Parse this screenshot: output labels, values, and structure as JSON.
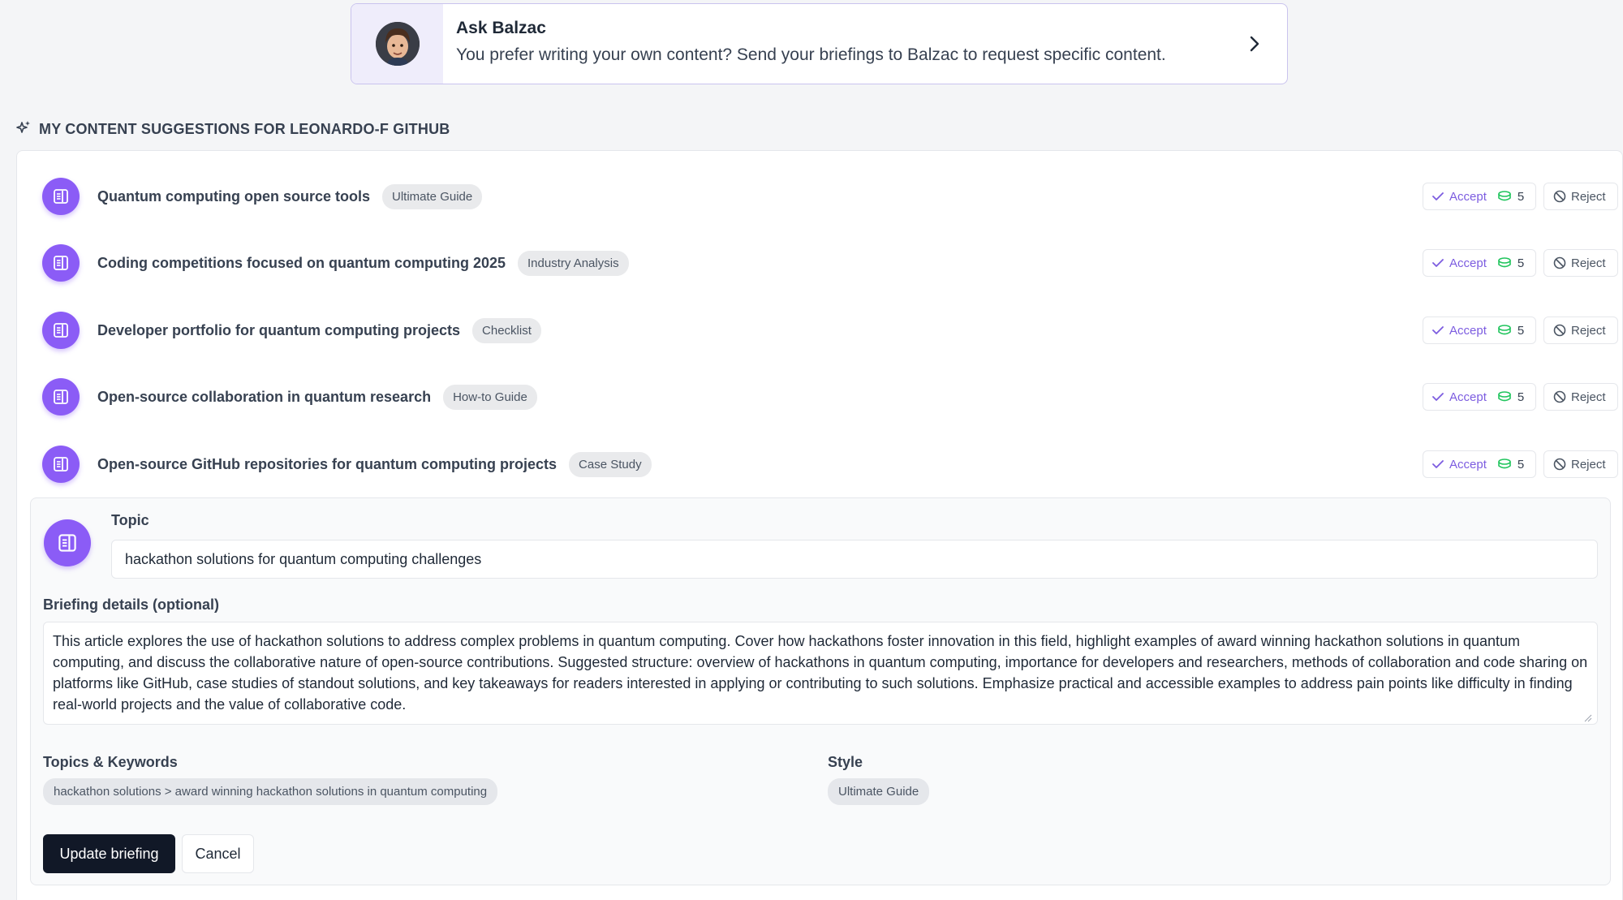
{
  "ask_banner": {
    "title": "Ask Balzac",
    "description": "You prefer writing your own content? Send your briefings to Balzac to request specific content."
  },
  "section": {
    "heading": "MY CONTENT SUGGESTIONS FOR LEONARDO-F GITHUB"
  },
  "suggestions": [
    {
      "title": "Quantum computing open source tools",
      "tag": "Ultimate Guide",
      "accept_label": "Accept",
      "credits": "5",
      "reject_label": "Reject"
    },
    {
      "title": "Coding competitions focused on quantum computing 2025",
      "tag": "Industry Analysis",
      "accept_label": "Accept",
      "credits": "5",
      "reject_label": "Reject"
    },
    {
      "title": "Developer portfolio for quantum computing projects",
      "tag": "Checklist",
      "accept_label": "Accept",
      "credits": "5",
      "reject_label": "Reject"
    },
    {
      "title": "Open-source collaboration in quantum research",
      "tag": "How-to Guide",
      "accept_label": "Accept",
      "credits": "5",
      "reject_label": "Reject"
    },
    {
      "title": "Open-source GitHub repositories for quantum computing projects",
      "tag": "Case Study",
      "accept_label": "Accept",
      "credits": "5",
      "reject_label": "Reject"
    }
  ],
  "editor": {
    "topic_label": "Topic",
    "topic_value": "hackathon solutions for quantum computing challenges",
    "briefing_label": "Briefing details (optional)",
    "briefing_value": "This article explores the use of hackathon solutions to address complex problems in quantum computing. Cover how hackathons foster innovation in this field, highlight examples of award winning hackathon solutions in quantum computing, and discuss the collaborative nature of open-source contributions. Suggested structure: overview of hackathons in quantum computing, importance for developers and researchers, methods of collaboration and code sharing on platforms like GitHub, case studies of standout solutions, and key takeaways for readers interested in applying or contributing to such solutions. Emphasize practical and accessible examples to address pain points like difficulty in finding real-world projects and the value of collaborative code.",
    "keywords_label": "Topics & Keywords",
    "keywords_chip": "hackathon solutions > award winning hackathon solutions in quantum computing",
    "style_label": "Style",
    "style_chip": "Ultimate Guide",
    "update_label": "Update briefing",
    "cancel_label": "Cancel"
  },
  "colors": {
    "accent": "#8b5cf6",
    "accept_text": "#7c5ce0",
    "credit_icon": "#22c55e",
    "primary_button": "#111827"
  },
  "icons": {
    "suggestion": "document-icon",
    "heading": "sparkles-icon",
    "accept": "check-icon",
    "credits": "coins-icon",
    "reject": "ban-icon",
    "banner": "chevron-right-icon"
  }
}
